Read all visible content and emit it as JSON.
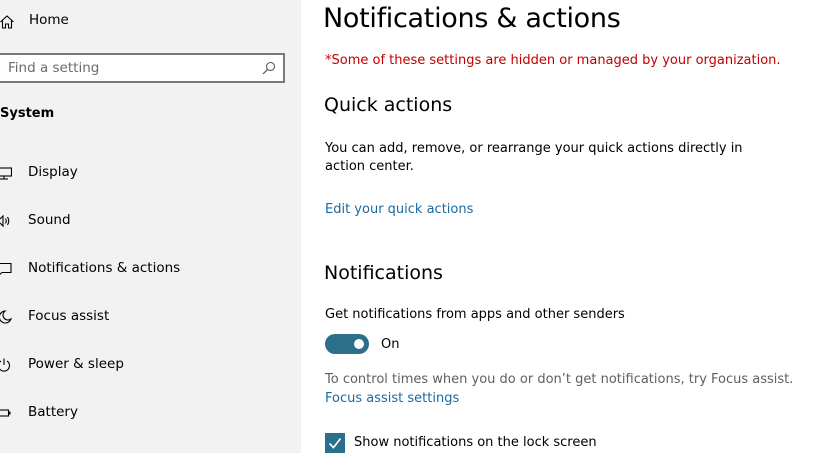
{
  "sidebar": {
    "home_label": "Home",
    "search_placeholder": "Find a setting",
    "section_title": "System",
    "items": [
      {
        "label": "Display",
        "icon": "display-icon"
      },
      {
        "label": "Sound",
        "icon": "sound-icon"
      },
      {
        "label": "Notifications & actions",
        "icon": "notifications-icon"
      },
      {
        "label": "Focus assist",
        "icon": "moon-icon"
      },
      {
        "label": "Power & sleep",
        "icon": "power-icon"
      },
      {
        "label": "Battery",
        "icon": "battery-icon"
      }
    ]
  },
  "main": {
    "title": "Notifications & actions",
    "warning": "*Some of these settings are hidden or managed by your organization.",
    "quick_actions": {
      "heading": "Quick actions",
      "description": "You can add, remove, or rearrange your quick actions directly in action center.",
      "link": "Edit your quick actions"
    },
    "notifications": {
      "heading": "Notifications",
      "toggle_description": "Get notifications from apps and other senders",
      "toggle_state": "On",
      "focus_hint": "To control times when you do or don’t get notifications, try Focus assist.",
      "focus_link": "Focus assist settings",
      "lock_screen_label": "Show notifications on the lock screen",
      "lock_screen_checked": true
    }
  },
  "colors": {
    "accent": "#2b6f8a",
    "link": "#1a6aa0",
    "warning": "#c00000",
    "sidebar_bg": "#f2f2f2"
  }
}
